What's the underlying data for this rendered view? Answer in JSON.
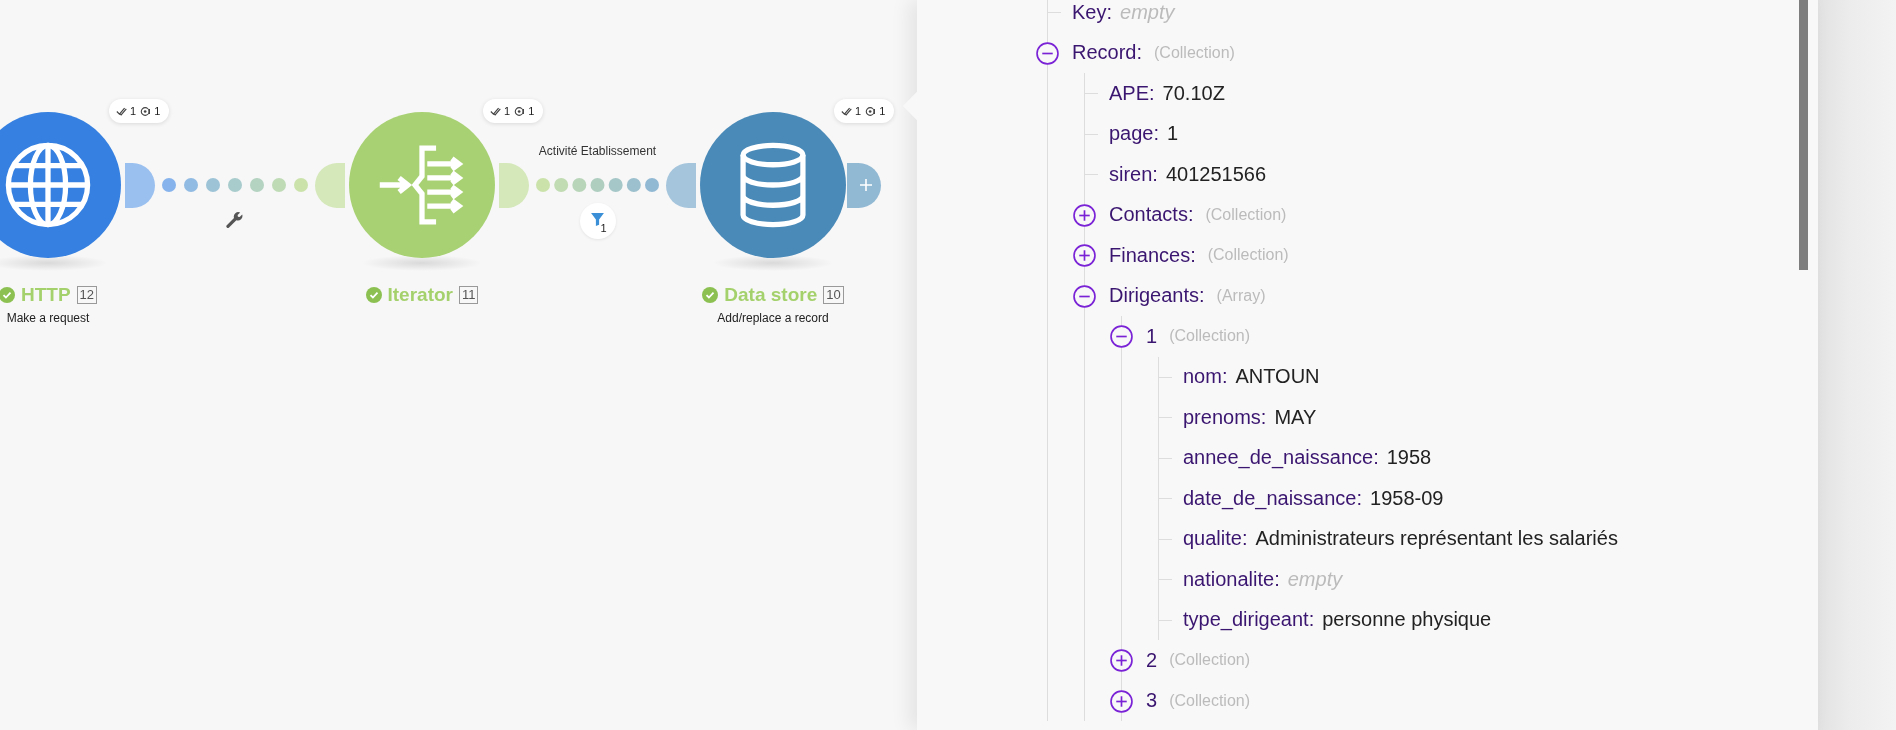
{
  "scenario": {
    "modules": [
      {
        "kind": "http",
        "name": "HTTP",
        "number": "12",
        "subtitle": "Make a request",
        "success": true,
        "color": "#3580e0",
        "operations": "1",
        "bundles": "1"
      },
      {
        "kind": "iterator",
        "name": "Iterator",
        "number": "11",
        "success": true,
        "color": "#a8d173",
        "operations": "1",
        "bundles": "1"
      },
      {
        "kind": "datastore",
        "name": "Data store",
        "number": "10",
        "subtitle": "Add/replace a record",
        "success": true,
        "color": "#4a8ab8",
        "operations": "1",
        "bundles": "1"
      }
    ],
    "connections": [
      {
        "kind": "mapping"
      },
      {
        "kind": "filter",
        "label": "Activité Etablissement",
        "filter_count": "1"
      }
    ]
  },
  "panel": {
    "tree": [
      {
        "kind": "empty",
        "key": "Key:",
        "value": "empty"
      },
      {
        "kind": "group",
        "key": "Record:",
        "type": "(Collection)",
        "expanded": true,
        "children": [
          {
            "kind": "field",
            "key": "APE:",
            "value": "70.10Z"
          },
          {
            "kind": "field",
            "key": "page:",
            "value": "1"
          },
          {
            "kind": "field",
            "key": "siren:",
            "value": "401251566"
          },
          {
            "kind": "group",
            "key": "Contacts:",
            "type": "(Collection)",
            "expanded": false
          },
          {
            "kind": "group",
            "key": "Finances:",
            "type": "(Collection)",
            "expanded": false
          },
          {
            "kind": "group",
            "key": "Dirigeants:",
            "type": "(Array)",
            "expanded": true,
            "children": [
              {
                "kind": "group",
                "key": "1",
                "type": "(Collection)",
                "expanded": true,
                "children": [
                  {
                    "kind": "field",
                    "key": "nom:",
                    "value": "ANTOUN"
                  },
                  {
                    "kind": "field",
                    "key": "prenoms:",
                    "value": "MAY"
                  },
                  {
                    "kind": "field",
                    "key": "annee_de_naissance:",
                    "value": "1958"
                  },
                  {
                    "kind": "field",
                    "key": "date_de_naissance:",
                    "value": "1958-09"
                  },
                  {
                    "kind": "field",
                    "key": "qualite:",
                    "value": "Administrateurs représentant les salariés"
                  },
                  {
                    "kind": "empty",
                    "key": "nationalite:",
                    "value": "empty"
                  },
                  {
                    "kind": "field",
                    "key": "type_dirigeant:",
                    "value": "personne physique"
                  }
                ]
              },
              {
                "kind": "group",
                "key": "2",
                "type": "(Collection)",
                "expanded": false
              },
              {
                "kind": "group",
                "key": "3",
                "type": "(Collection)",
                "expanded": false
              }
            ]
          }
        ]
      }
    ]
  }
}
